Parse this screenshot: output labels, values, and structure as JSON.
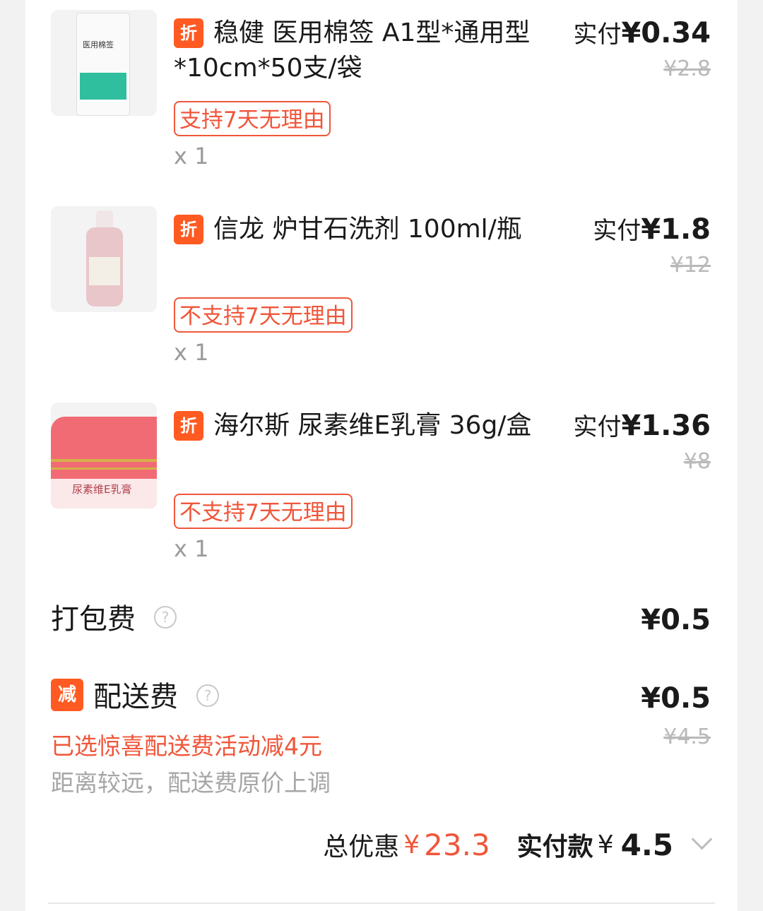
{
  "items": [
    {
      "badge": "折",
      "title": "稳健 医用棉签 A1型*通用型*10cm*50支/袋",
      "price_prefix": "实付",
      "price_value": "¥0.34",
      "original_price": "¥2.8",
      "return_tag": "支持7天无理由",
      "quantity": "x 1",
      "thumb_icon": "cotton-swab-pack-image",
      "thumb_text": "医用棉签"
    },
    {
      "badge": "折",
      "title": "信龙 炉甘石洗剂 100ml/瓶",
      "price_prefix": "实付",
      "price_value": "¥1.8",
      "original_price": "¥12",
      "return_tag": "不支持7天无理由",
      "quantity": "x 1",
      "thumb_icon": "lotion-bottle-image"
    },
    {
      "badge": "折",
      "title": "海尔斯 尿素维E乳膏 36g/盒",
      "price_prefix": "实付",
      "price_value": "¥1.36",
      "original_price": "¥8",
      "return_tag": "不支持7天无理由",
      "quantity": "x 1",
      "thumb_icon": "cream-jar-image",
      "thumb_text": "尿素维E乳膏"
    }
  ],
  "packing_fee": {
    "label": "打包费",
    "help": "?",
    "value": "¥0.5"
  },
  "delivery_fee": {
    "badge": "减",
    "label": "配送费",
    "help": "?",
    "value": "¥0.5",
    "original": "¥4.5",
    "promo": "已选惊喜配送费活动减4元",
    "note": "距离较远，配送费原价上调"
  },
  "summary": {
    "discount_label": "总优惠",
    "discount_currency": "¥",
    "discount_value": "23.3",
    "paid_label": "实付款",
    "paid_currency": "¥",
    "paid_value": "4.5"
  },
  "colors": {
    "accent": "#ff5a22",
    "tag_red": "#f0563a",
    "muted": "#a6a6a6"
  }
}
